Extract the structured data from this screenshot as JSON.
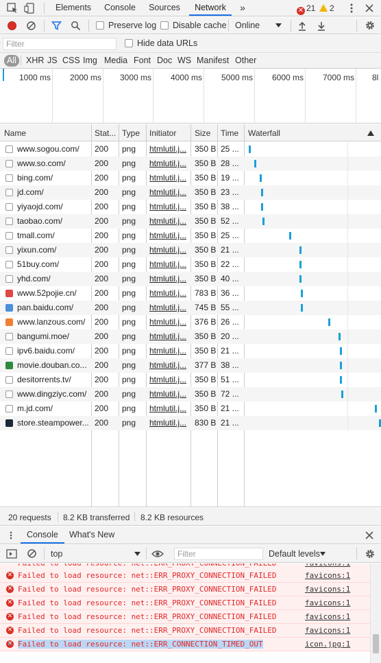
{
  "top_tabs": [
    {
      "label": "Elements"
    },
    {
      "label": "Console"
    },
    {
      "label": "Sources"
    },
    {
      "label": "Network",
      "active": true
    }
  ],
  "more_tabs_icon": "»",
  "errors_count": "21",
  "warnings_count": "2",
  "toolbar": {
    "preserve_log": "Preserve log",
    "disable_cache": "Disable cache",
    "throttle": "Online"
  },
  "filter": {
    "placeholder": "Filter",
    "hide_data_urls": "Hide data URLs"
  },
  "types": [
    "All",
    "XHR",
    "JS",
    "CSS",
    "Img",
    "Media",
    "Font",
    "Doc",
    "WS",
    "Manifest",
    "Other"
  ],
  "overview_ticks": [
    "1000 ms",
    "2000 ms",
    "3000 ms",
    "4000 ms",
    "5000 ms",
    "6000 ms",
    "7000 ms",
    "8l"
  ],
  "columns": {
    "name": "Name",
    "status": "Stat...",
    "type": "Type",
    "initiator": "Initiator",
    "size": "Size",
    "time": "Time",
    "waterfall": "Waterfall"
  },
  "rows": [
    {
      "name": "www.sogou.com/",
      "status": "200",
      "type": "png",
      "initiator": "htmlutil.j...",
      "size": "350 B",
      "time": "25 ...",
      "wf": 0.02
    },
    {
      "name": "www.so.com/",
      "status": "200",
      "type": "png",
      "initiator": "htmlutil.j...",
      "size": "350 B",
      "time": "28 ...",
      "wf": 0.06
    },
    {
      "name": "bing.com/",
      "status": "200",
      "type": "png",
      "initiator": "htmlutil.j...",
      "size": "350 B",
      "time": "19 ...",
      "wf": 0.1
    },
    {
      "name": "jd.com/",
      "status": "200",
      "type": "png",
      "initiator": "htmlutil.j...",
      "size": "350 B",
      "time": "23 ...",
      "wf": 0.11
    },
    {
      "name": "yiyaojd.com/",
      "status": "200",
      "type": "png",
      "initiator": "htmlutil.j...",
      "size": "350 B",
      "time": "38 ...",
      "wf": 0.11
    },
    {
      "name": "taobao.com/",
      "status": "200",
      "type": "png",
      "initiator": "htmlutil.j...",
      "size": "350 B",
      "time": "52 ...",
      "wf": 0.12
    },
    {
      "name": "tmall.com/",
      "status": "200",
      "type": "png",
      "initiator": "htmlutil.j...",
      "size": "350 B",
      "time": "25 ...",
      "wf": 0.32
    },
    {
      "name": "yixun.com/",
      "status": "200",
      "type": "png",
      "initiator": "htmlutil.j...",
      "size": "350 B",
      "time": "21 ...",
      "wf": 0.4
    },
    {
      "name": "51buy.com/",
      "status": "200",
      "type": "png",
      "initiator": "htmlutil.j...",
      "size": "350 B",
      "time": "22 ...",
      "wf": 0.4
    },
    {
      "name": "yhd.com/",
      "status": "200",
      "type": "png",
      "initiator": "htmlutil.j...",
      "size": "350 B",
      "time": "40 ...",
      "wf": 0.4
    },
    {
      "name": "www.52pojie.cn/",
      "status": "200",
      "type": "png",
      "initiator": "htmlutil.j...",
      "size": "783 B",
      "time": "36 ...",
      "wf": 0.41
    },
    {
      "name": "pan.baidu.com/",
      "status": "200",
      "type": "png",
      "initiator": "htmlutil.j...",
      "size": "745 B",
      "time": "55 ...",
      "wf": 0.41
    },
    {
      "name": "www.lanzous.com/",
      "status": "200",
      "type": "png",
      "initiator": "htmlutil.j...",
      "size": "376 B",
      "time": "26 ...",
      "wf": 0.61
    },
    {
      "name": "bangumi.moe/",
      "status": "200",
      "type": "png",
      "initiator": "htmlutil.j...",
      "size": "350 B",
      "time": "20 ...",
      "wf": 0.69
    },
    {
      "name": "ipv6.baidu.com/",
      "status": "200",
      "type": "png",
      "initiator": "htmlutil.j...",
      "size": "350 B",
      "time": "21 ...",
      "wf": 0.7
    },
    {
      "name": "movie.douban.co...",
      "status": "200",
      "type": "png",
      "initiator": "htmlutil.j...",
      "size": "377 B",
      "time": "38 ...",
      "wf": 0.7
    },
    {
      "name": "desitorrents.tv/",
      "status": "200",
      "type": "png",
      "initiator": "htmlutil.j...",
      "size": "350 B",
      "time": "51 ...",
      "wf": 0.7
    },
    {
      "name": "www.dingziyc.com/",
      "status": "200",
      "type": "png",
      "initiator": "htmlutil.j...",
      "size": "350 B",
      "time": "72 ...",
      "wf": 0.71
    },
    {
      "name": "m.jd.com/",
      "status": "200",
      "type": "png",
      "initiator": "htmlutil.j...",
      "size": "350 B",
      "time": "21 ...",
      "wf": 0.96
    },
    {
      "name": "store.steampower...",
      "status": "200",
      "type": "png",
      "initiator": "htmlutil.j...",
      "size": "830 B",
      "time": "21 ...",
      "wf": 0.99
    }
  ],
  "status": {
    "requests": "20 requests",
    "transferred": "8.2 KB transferred",
    "resources": "8.2 KB resources"
  },
  "drawer": {
    "tab_console": "Console",
    "tab_whats_new": "What's New",
    "context": "top",
    "filter_placeholder": "Filter",
    "levels": "Default levels"
  },
  "console_lines": [
    {
      "msg": "Failed to load resource: net::ERR_PROXY_CONNECTION_FAILED",
      "src": "favicons:1"
    },
    {
      "msg": "Failed to load resource: net::ERR_PROXY_CONNECTION_FAILED",
      "src": "favicons:1"
    },
    {
      "msg": "Failed to load resource: net::ERR_PROXY_CONNECTION_FAILED",
      "src": "favicons:1"
    },
    {
      "msg": "Failed to load resource: net::ERR_PROXY_CONNECTION_FAILED",
      "src": "favicons:1"
    },
    {
      "msg": "Failed to load resource: net::ERR_PROXY_CONNECTION_FAILED",
      "src": "favicons:1"
    },
    {
      "msg": "Failed to load resource: net::ERR_CONNECTION_TIMED_OUT",
      "src": "icon.jpg:1",
      "selected": true
    }
  ],
  "colors": {
    "accent": "#1a73e8",
    "error": "#d93025",
    "waterfall": "#1a9fd9"
  }
}
